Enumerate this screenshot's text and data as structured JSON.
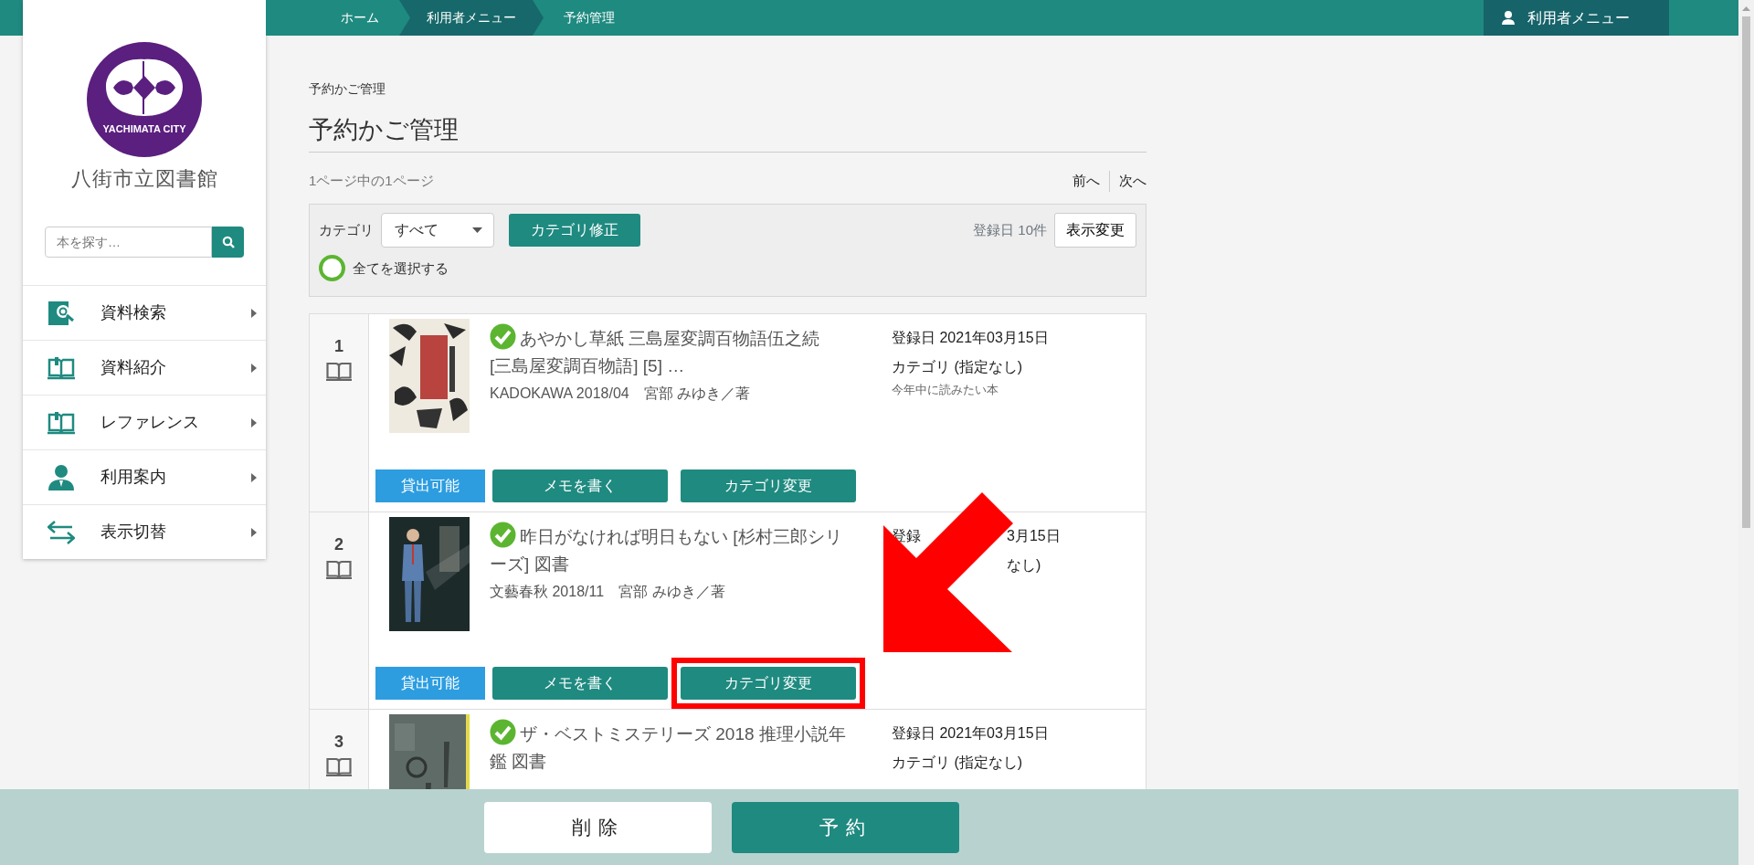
{
  "breadcrumb": [
    {
      "label": "ホーム",
      "selected": false
    },
    {
      "label": "利用者メニュー",
      "selected": true
    },
    {
      "label": "予約管理",
      "selected": false
    }
  ],
  "user_menu": {
    "label": "利用者メニュー"
  },
  "sidebar": {
    "logo_text": "YACHIMATA CITY",
    "library_name": "八街市立図書館",
    "search": {
      "placeholder": "本を探す…"
    },
    "items": [
      {
        "label": "資料検索"
      },
      {
        "label": "資料紹介"
      },
      {
        "label": "レファレンス"
      },
      {
        "label": "利用案内"
      },
      {
        "label": "表示切替"
      }
    ]
  },
  "page": {
    "breadcrumb_title": "予約かご管理",
    "title": "予約かご管理",
    "page_info": "1ページ中の1ページ",
    "prev": "前へ",
    "next": "次へ"
  },
  "filter": {
    "label": "カテゴリ",
    "select_value": "すべて",
    "apply_button": "カテゴリ修正",
    "sort_info": "登録日 10件",
    "display_button": "表示変更",
    "select_all": {
      "label": "全てを選択する",
      "checked": false
    }
  },
  "items": [
    {
      "number": "1",
      "checked": true,
      "title": "あやかし草紙 三島屋変調百物語伍之続 [三島屋変調百物語] [5] …",
      "details": "KADOKAWA 2018/04　宮部 みゆき／著",
      "info": [
        {
          "kind": "date",
          "left": "登録日 2021年03月15日"
        },
        {
          "kind": "category",
          "left": "カテゴリ (指定なし)"
        },
        {
          "kind": "memo",
          "left": "今年中に読みたい本"
        }
      ],
      "buttons": [
        {
          "kind": "status",
          "label": "貸出可能"
        },
        {
          "kind": "action",
          "label": "メモを書く",
          "highlighted": false
        },
        {
          "kind": "action",
          "label": "カテゴリ変更",
          "highlighted": false
        }
      ]
    },
    {
      "number": "2",
      "checked": true,
      "title": "昨日がなければ明日もない [杉村三郎シリーズ] 図書",
      "details": "文藝春秋 2018/11　宮部 みゆき／著",
      "info": [
        {
          "kind": "date",
          "left": "登録",
          "right": "3月15日"
        },
        {
          "kind": "category",
          "right": "なし)"
        }
      ],
      "buttons": [
        {
          "kind": "status",
          "label": "貸出可能"
        },
        {
          "kind": "action",
          "label": "メモを書く",
          "highlighted": false
        },
        {
          "kind": "action",
          "label": "カテゴリ変更",
          "highlighted": true
        }
      ]
    },
    {
      "number": "3",
      "checked": true,
      "title": "ザ・ベストミステリーズ 2018 推理小説年鑑 図書",
      "info": [
        {
          "kind": "date",
          "left": "登録日 2021年03月15日"
        },
        {
          "kind": "category",
          "left": "カテゴリ (指定なし)"
        }
      ]
    }
  ],
  "callout_arrow": true,
  "footer": {
    "buttons": [
      {
        "kind": "secondary",
        "label": "削除"
      },
      {
        "kind": "primary",
        "label": "予約"
      }
    ]
  }
}
